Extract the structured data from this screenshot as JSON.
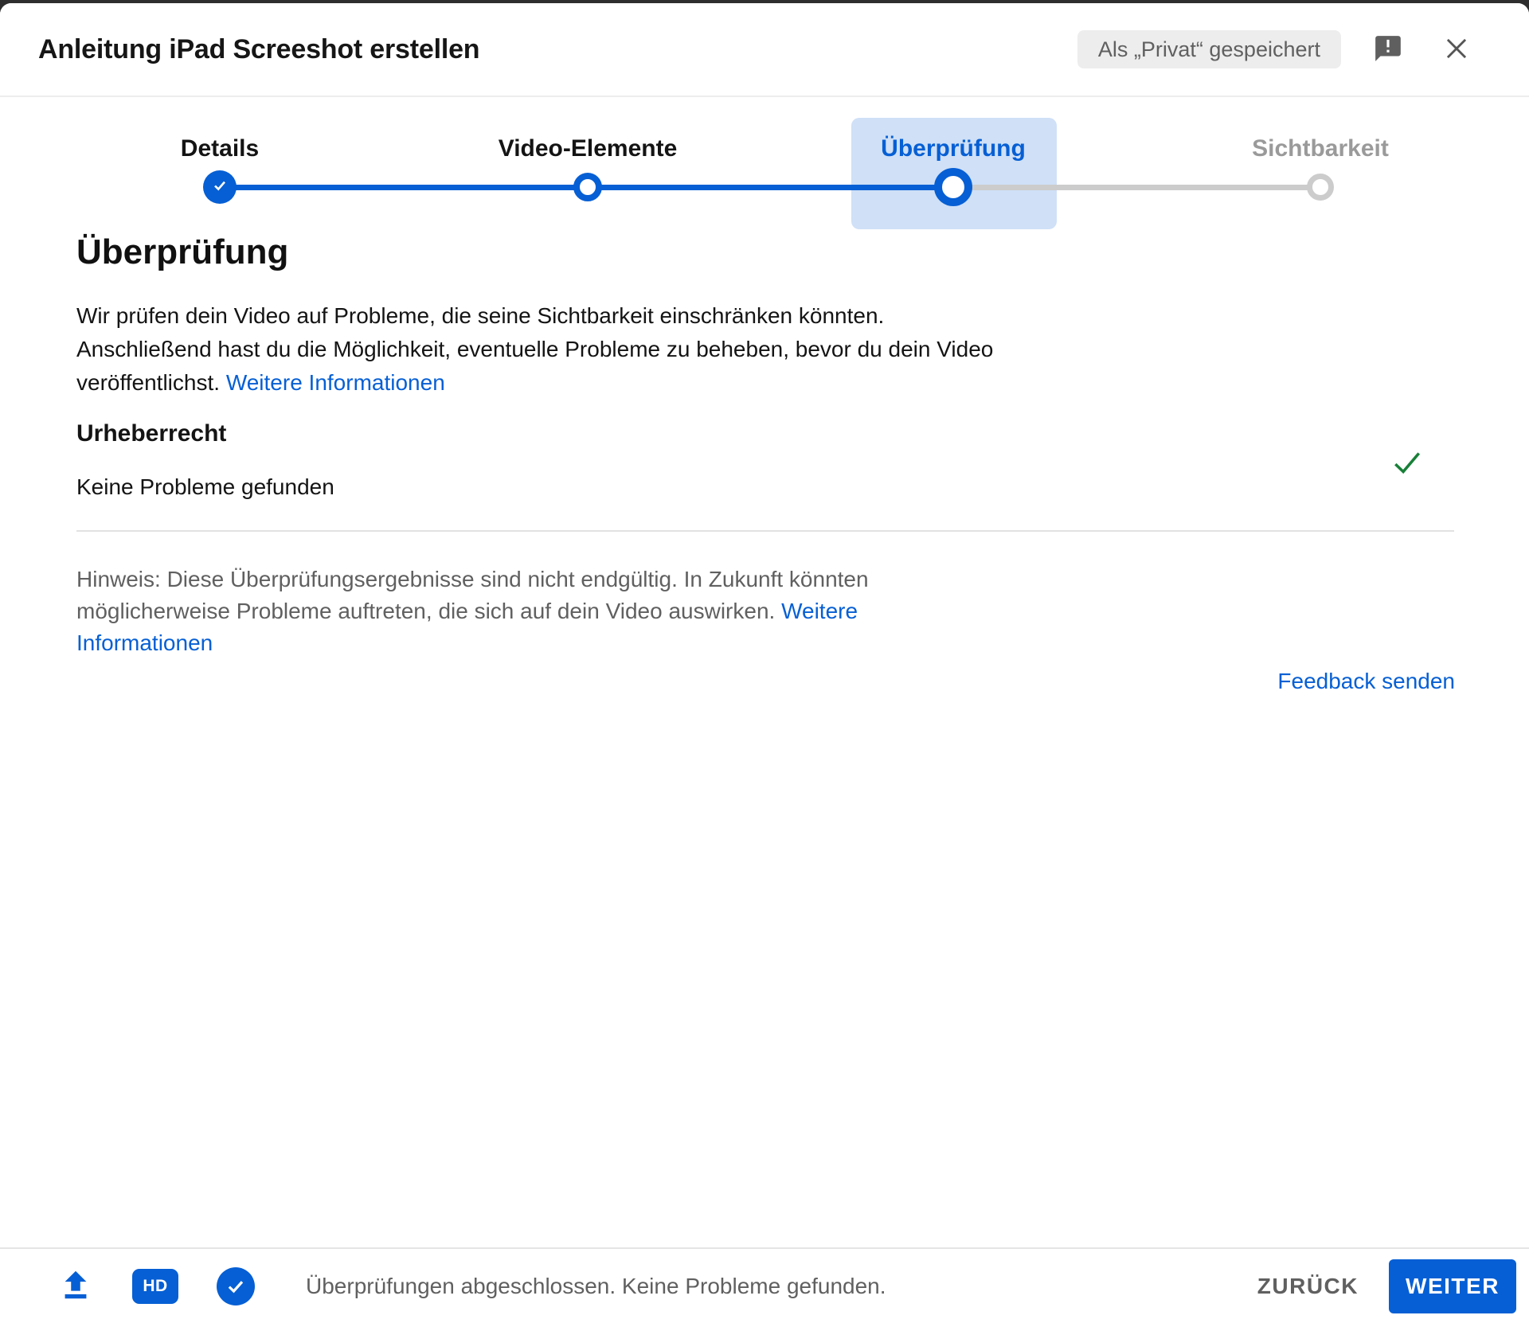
{
  "header": {
    "title": "Anleitung iPad Screeshot erstellen",
    "saved_badge": "Als „Privat“ gespeichert"
  },
  "stepper": {
    "steps": [
      {
        "label": "Details",
        "state": "completed"
      },
      {
        "label": "Video-Elemente",
        "state": "completed"
      },
      {
        "label": "Überprüfung",
        "state": "current"
      },
      {
        "label": "Sichtbarkeit",
        "state": "upcoming"
      }
    ]
  },
  "content": {
    "heading": "Überprüfung",
    "intro_line1": "Wir prüfen dein Video auf Probleme, die seine Sichtbarkeit einschränken könnten.",
    "intro_line2": "Anschließend hast du die Möglichkeit, eventuelle Probleme zu beheben, bevor du dein Video",
    "intro_line3_prefix": "veröffentlichst.",
    "intro_link": "Weitere Informationen",
    "copyright_title": "Urheberrecht",
    "copyright_status": "Keine Probleme gefunden",
    "note_line1": "Hinweis: Diese Überprüfungsergebnisse sind nicht endgültig. In Zukunft könnten",
    "note_line2": "möglicherweise Probleme auftreten, die sich auf dein Video auswirken.",
    "note_link_word1": "Weitere",
    "note_link_word2": "Informationen",
    "feedback_link": "Feedback senden"
  },
  "footer": {
    "hd_label": "HD",
    "status": "Überprüfungen abgeschlossen. Keine Probleme gefunden.",
    "back_button": "ZURÜCK",
    "next_button": "WEITER"
  },
  "colors": {
    "accent_blue": "#065fd4",
    "active_step_bg": "#cfe0f7",
    "success_green": "#188038",
    "muted_gray": "#606060"
  }
}
